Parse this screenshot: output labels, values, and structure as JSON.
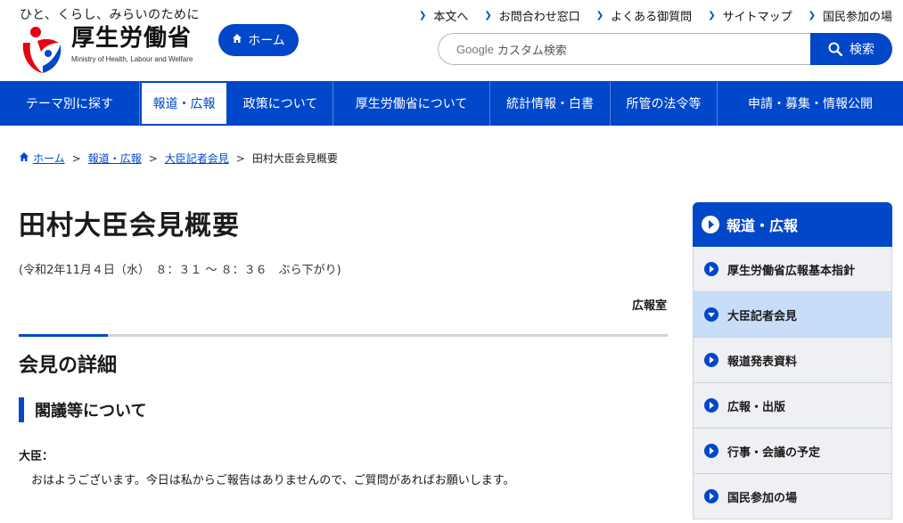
{
  "header": {
    "tagline": "ひと、くらし、みらいのために",
    "logo_jp": "厚生労働省",
    "logo_en": "Ministry of Health, Labour and Welfare",
    "home_label": "ホーム",
    "util_links": [
      "本文へ",
      "お問合わせ窓口",
      "よくある御質問",
      "サイトマップ",
      "国民参加の場"
    ],
    "search_brand": "Google",
    "search_placeholder": "カスタム検索",
    "search_button": "検索"
  },
  "gnav": {
    "items": [
      "テーマ別に探す",
      "報道・広報",
      "政策について",
      "厚生労働省について",
      "統計情報・白書",
      "所管の法令等",
      "申請・募集・情報公開"
    ],
    "active_index": 1
  },
  "breadcrumb": [
    "ホーム",
    "報道・広報",
    "大臣記者会見",
    "田村大臣会見概要"
  ],
  "main": {
    "title": "田村大臣会見概要",
    "date": "(令和2年11月４日（水）　８：３１ ～ ８：３６　ぶら下がり)",
    "office": "広報室",
    "section_heading": "会見の詳細",
    "subsection_heading": "閣議等について",
    "speaker": "大臣：",
    "speech": "おはようございます。今日は私からご報告はありませんので、ご質問があればお願いします。"
  },
  "sidebar": {
    "heading": "報道・広報",
    "items": [
      "厚生労働省広報基本指針",
      "大臣記者会見",
      "報道発表資料",
      "広報・出版",
      "行事・会議の予定",
      "国民参加の場"
    ],
    "current_index": 1
  },
  "colors": {
    "brand_blue": "#0047c9",
    "sidebar_bg": "#eef0f3",
    "sidebar_current": "#c8ddf7"
  }
}
